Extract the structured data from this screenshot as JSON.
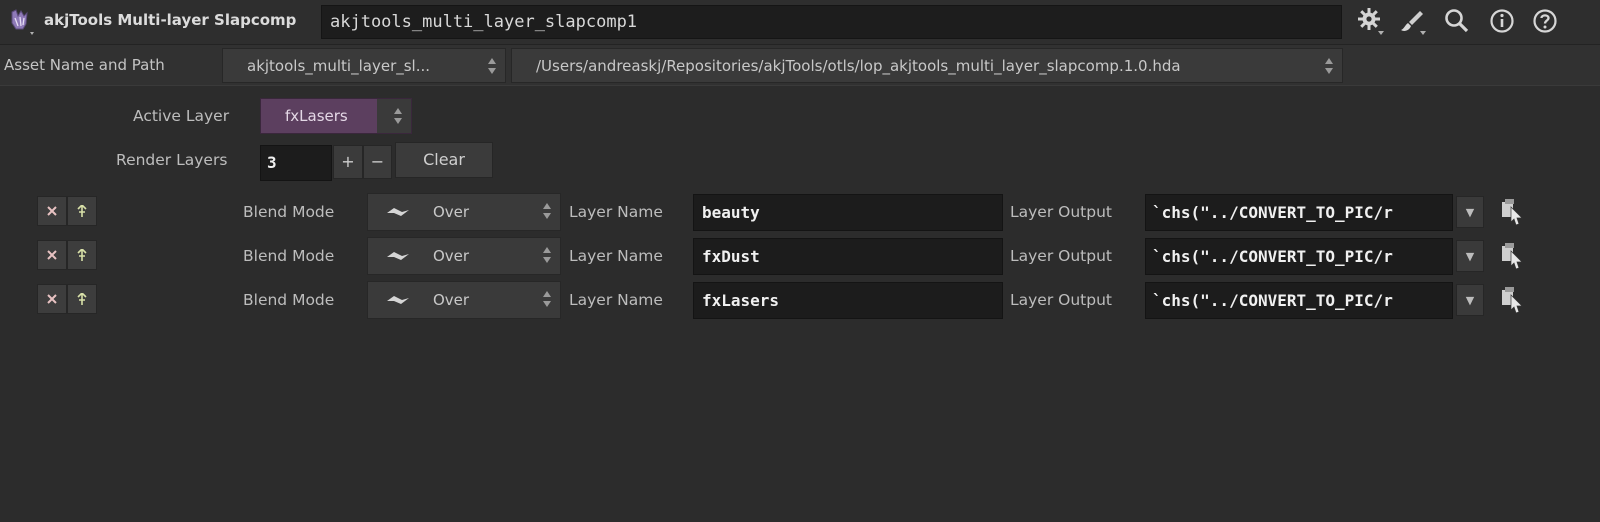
{
  "header": {
    "node_type": "akjTools Multi-layer Slapcomp",
    "node_name": "akjtools_multi_layer_slapcomp1",
    "icons": [
      "node-type-icon",
      "gear-icon",
      "brush-icon",
      "search-icon",
      "info-icon",
      "help-icon"
    ]
  },
  "asset": {
    "label": "Asset Name and Path",
    "name_value": "akjtools_multi_layer_sl...",
    "path_value": "/Users/andreaskj/Repositories/akjTools/otls/lop_akjtools_multi_layer_slapcomp.1.0.hda"
  },
  "active_layer": {
    "label": "Active Layer",
    "value": "fxLasers",
    "accent": "#5c3f5f"
  },
  "render_layers": {
    "label": "Render Layers",
    "count": "3",
    "plus": "+",
    "minus": "−",
    "clear_label": "Clear"
  },
  "layers": [
    {
      "blend_label": "Blend Mode",
      "blend_value": "Over",
      "name_label": "Layer Name",
      "name_value": "beauty",
      "output_label": "Layer Output",
      "output_value": "`chs(\"../CONVERT_TO_PIC/r"
    },
    {
      "blend_label": "Blend Mode",
      "blend_value": "Over",
      "name_label": "Layer Name",
      "name_value": "fxDust",
      "output_label": "Layer Output",
      "output_value": "`chs(\"../CONVERT_TO_PIC/r"
    },
    {
      "blend_label": "Blend Mode",
      "blend_value": "Over",
      "name_label": "Layer Name",
      "name_value": "fxLasers",
      "output_label": "Layer Output",
      "output_value": "`chs(\"../CONVERT_TO_PIC/r"
    }
  ]
}
